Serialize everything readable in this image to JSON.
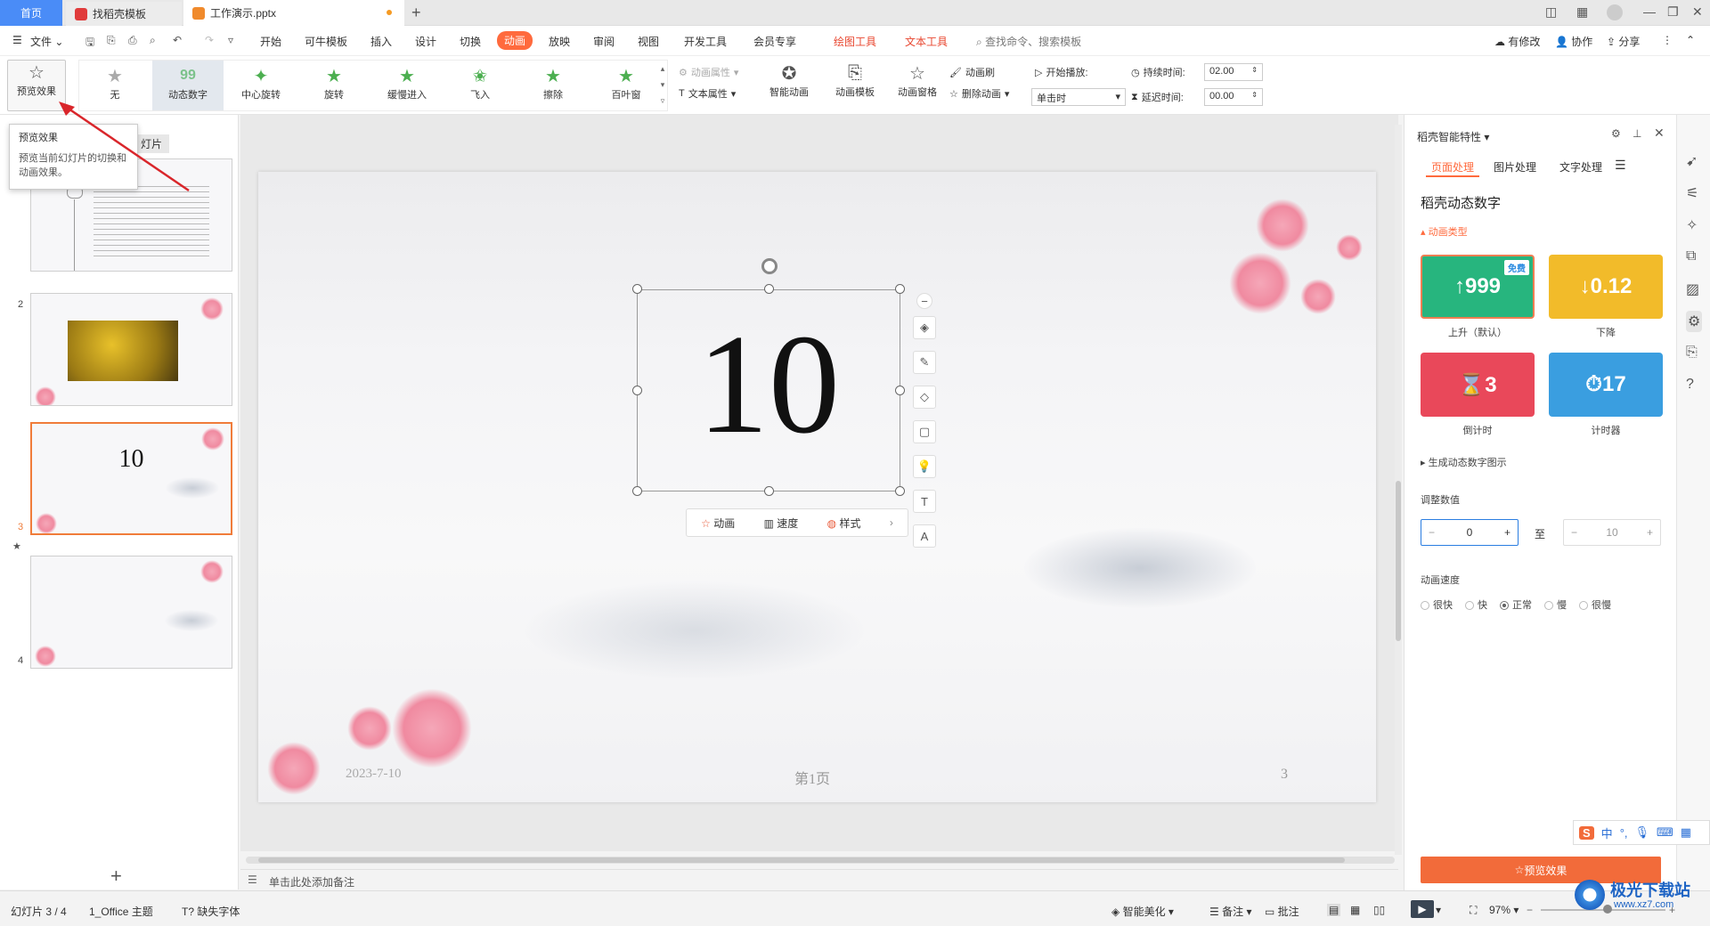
{
  "tabs": {
    "home": "首页",
    "template": "找稻壳模板",
    "document": "工作演示.pptx"
  },
  "menu": {
    "file": "文件",
    "items": [
      "开始",
      "可牛模板",
      "插入",
      "设计",
      "切换",
      "动画",
      "放映",
      "审阅",
      "视图",
      "开发工具",
      "会员专享"
    ],
    "active": "动画",
    "context_tools": [
      "绘图工具",
      "文本工具"
    ],
    "search_placeholder": "查找命令、搜索模板",
    "changes": "有修改",
    "collaborate": "协作",
    "share": "分享"
  },
  "ribbon": {
    "preview": "预览效果",
    "effects": [
      "无",
      "动态数字",
      "中心旋转",
      "旋转",
      "缓慢进入",
      "飞入",
      "擦除",
      "百叶窗"
    ],
    "selected_effect": "动态数字",
    "anim_props": "动画属性",
    "text_props": "文本属性",
    "smart_anim": "智能动画",
    "anim_template": "动画模板",
    "anim_pane": "动画窗格",
    "anim_brush": "动画刷",
    "delete_anim": "删除动画",
    "start_play": "开始播放:",
    "on_click": "单击时",
    "duration_label": "持续时间:",
    "duration_value": "02.00",
    "delay_label": "延迟时间:",
    "delay_value": "00.00"
  },
  "tooltip": {
    "title": "预览效果",
    "body": "预览当前幻灯片的切换和动画效果。"
  },
  "slides_pane": {
    "tab_label": "灯片",
    "numbers": [
      "2",
      "3",
      "4"
    ],
    "slide3_text": "10",
    "add": "+"
  },
  "slide": {
    "number": "10",
    "date": "2023-7-10",
    "page_label": "第1页",
    "page_num": "3"
  },
  "mini_toolbar": {
    "animation": "动画",
    "speed": "速度",
    "style": "样式"
  },
  "notes_placeholder": "单击此处添加备注",
  "right_panel": {
    "title": "稻壳智能特性",
    "tabs": [
      "页面处理",
      "图片处理",
      "文字处理"
    ],
    "section_title": "稻壳动态数字",
    "anim_type": "动画类型",
    "cards": [
      {
        "value": "↑999",
        "label": "上升（默认）",
        "color": "#27b57e",
        "badge": "免费"
      },
      {
        "value": "↓0.12",
        "label": "下降",
        "color": "#f2bb2a"
      },
      {
        "value": "⌛3",
        "label": "倒计时",
        "color": "#e9485a"
      },
      {
        "value": "⏱17",
        "label": "计时器",
        "color": "#3a9ee0"
      }
    ],
    "gen_chart": "生成动态数字图示",
    "adjust_label": "调整数值",
    "from_value": "0",
    "to_label": "至",
    "to_value": "10",
    "speed_label": "动画速度",
    "speeds": [
      "很快",
      "快",
      "正常",
      "慢",
      "很慢"
    ],
    "selected_speed": "正常",
    "preview_button": "预览效果"
  },
  "status": {
    "slide_info": "幻灯片 3 / 4",
    "theme": "1_Office 主题",
    "missing_font": "缺失字体",
    "beautify": "智能美化",
    "notes": "备注",
    "comments": "批注",
    "zoom": "97%"
  },
  "ime": {
    "lang": "中"
  },
  "watermark": {
    "site": "极光下载站",
    "url": "www.xz7.com"
  },
  "colors": {
    "accent": "#ff6a3d",
    "home_tab": "#4a8cf7",
    "preview_btn": "#f26b3a"
  }
}
